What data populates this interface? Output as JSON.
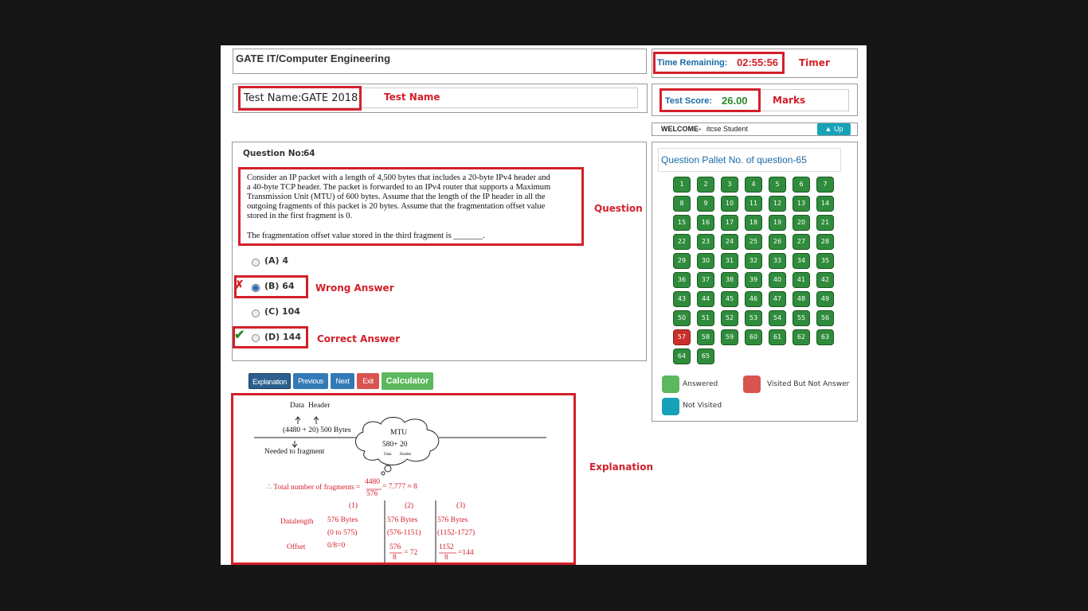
{
  "header": {
    "exam_title": "GATE IT/Computer Engineering",
    "test_name_label": "Test Name:",
    "test_name_value": "GATE 2018",
    "time_label": "Time Remaining:",
    "time_value": "02:55:56",
    "score_label": "Test Score:",
    "score_value": "26.00",
    "welcome_label": "WELCOME-",
    "welcome_user": "itcse Student",
    "up_button": "Up"
  },
  "annotations": {
    "timer": "Timer",
    "test_name": "Test Name",
    "marks": "Marks",
    "question": "Question",
    "wrong_answer": "Wrong Answer",
    "correct_answer": "Correct Answer",
    "explanation": "Explanation"
  },
  "question": {
    "number_label": "Question No:",
    "number": "64",
    "lines": [
      "Consider an IP packet with a length of 4,500 bytes that includes a 20-byte IPv4 header and",
      "a 40-byte TCP header. The packet is forwarded to an IPv4 router that supports a Maximum",
      "Transmission Unit (MTU) of 600 bytes. Assume that the length of the IP header in all the",
      "outgoing fragments of this packet is 20 bytes. Assume that the fragmentation offset value",
      "stored in the first fragment is 0."
    ],
    "prompt": "The fragmentation offset value stored in the third fragment is _______.",
    "options": [
      "(A) 4",
      "(B) 64",
      "(C) 104",
      "(D) 144"
    ],
    "selected_index": 1,
    "correct_index": 3
  },
  "buttons": {
    "explanation": "Explanation",
    "previous": "Previous",
    "next": "Next",
    "exit": "Exit",
    "calculator": "Calculator"
  },
  "colors": {
    "answered": "#2f8c3c",
    "visited_not_answered": "#c9302c",
    "not_visited": "#17a2b8",
    "annotation_red": "#d3202a"
  },
  "palette": {
    "title": "Question Pallet No. of question-65",
    "numbers": [
      "1",
      "2",
      "3",
      "4",
      "5",
      "6",
      "7",
      "8",
      "9",
      "10",
      "11",
      "12",
      "13",
      "14",
      "15",
      "16",
      "17",
      "18",
      "19",
      "20",
      "21",
      "22",
      "23",
      "24",
      "25",
      "26",
      "27",
      "28",
      "29",
      "30",
      "31",
      "32",
      "33",
      "34",
      "35",
      "36",
      "37",
      "38",
      "39",
      "40",
      "41",
      "42",
      "43",
      "44",
      "45",
      "46",
      "47",
      "48",
      "49",
      "50",
      "51",
      "52",
      "53",
      "54",
      "55",
      "56",
      "57",
      "58",
      "59",
      "60",
      "61",
      "62",
      "63",
      "64",
      "65"
    ],
    "visited_not_answered": [
      "57"
    ],
    "legend": {
      "answered": "Answered",
      "visited": "Visited But Not Answer",
      "not_visited": "Not Visited"
    }
  },
  "explanation": {
    "data": "Data",
    "header": "Header",
    "expr": "(4480 + 20) 500 Bytes",
    "needed": "Needed to fragment",
    "mtu": "MTU",
    "mtu_expr": "580+ 20",
    "mtu_data": "Data",
    "mtu_header": "Header",
    "total_prefix": "∴ Total number of fragments =",
    "total_num": "4480",
    "total_den": "576",
    "total_result": "= 7.777 ≈ 8",
    "col1": "(1)",
    "col2": "(2)",
    "col3": "(3)",
    "datalength_label": "Datalength",
    "offset_label": "Offset",
    "c1_len": "576 Bytes",
    "c1_range": "(0 to 575)",
    "c1_off": "0/8=0",
    "c2_len": "576 Bytes",
    "c2_range": "(576-1151)",
    "c2_num": "576",
    "c2_den": "8",
    "c2_res": "= 72",
    "c3_len": "576 Bytes",
    "c3_range": "(1152-1727)",
    "c3_num": "1152",
    "c3_den": "8",
    "c3_res": "=144"
  }
}
